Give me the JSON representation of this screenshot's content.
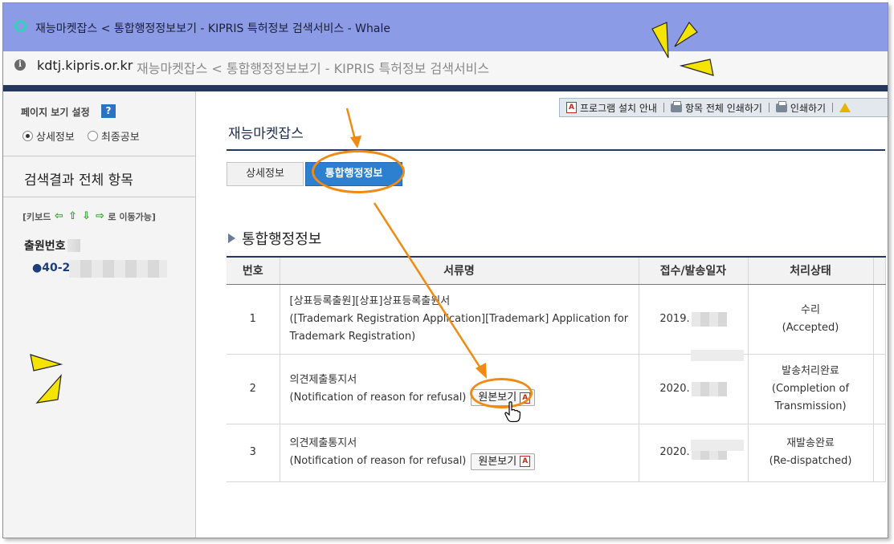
{
  "browser": {
    "window_title": "재능마켓잡스 < 통합행정정보보기 - KIPRIS 특허정보 검색서비스 - Whale",
    "url": "kdtj.kipris.or.kr",
    "page_title": "재능마켓잡스 < 통합행정정보보기 - KIPRIS 특허정보 검색서비스"
  },
  "sidebar": {
    "view_setting_title": "페이지 보기 설정",
    "help_label": "?",
    "radio_detail": "상세정보",
    "radio_final": "최종공보",
    "all_items_title": "검색결과 전체 항목",
    "keyboard_hint_prefix": "[키보드",
    "keyboard_hint_suffix": "로 이동가능]",
    "application_number_label": "출원번호",
    "application_number_value": "●40-2"
  },
  "toolbar": {
    "install_guide": "프로그램 설치 안내",
    "print_all": "항목 전체 인쇄하기",
    "print": "인쇄하기"
  },
  "content": {
    "title": "재능마켓잡스",
    "tab_detail": "상세정보",
    "tab_integrated": "통합행정정보",
    "section_title": "통합행정정보"
  },
  "table": {
    "headers": [
      "번호",
      "서류명",
      "접수/발송일자",
      "처리상태"
    ],
    "view_original_label": "원본보기",
    "rows": [
      {
        "no": "1",
        "doc_ko": "[상표등록출원][상표]상표등록출원서",
        "doc_en": "([Trademark Registration Application][Trademark] Application for Trademark Registration)",
        "date": "2019.",
        "status_ko": "수리",
        "status_en": "(Accepted)"
      },
      {
        "no": "2",
        "doc_ko": "의견제출통지서",
        "doc_en": "(Notification of reason for refusal)",
        "date": "2020.",
        "status_ko": "발송처리완료",
        "status_en": "(Completion of Transmission)"
      },
      {
        "no": "3",
        "doc_ko": "의견제출통지서",
        "doc_en": "(Notification of reason for refusal)",
        "date": "2020.",
        "status_ko": "재발송완료",
        "status_en": "(Re-dispatched)"
      }
    ]
  },
  "colors": {
    "titlebar": "#8b9be6",
    "navy": "#26375e",
    "active_tab": "#2d7fd0",
    "annotation_orange": "#f08a12",
    "highlight_yellow": "#f5e400"
  }
}
